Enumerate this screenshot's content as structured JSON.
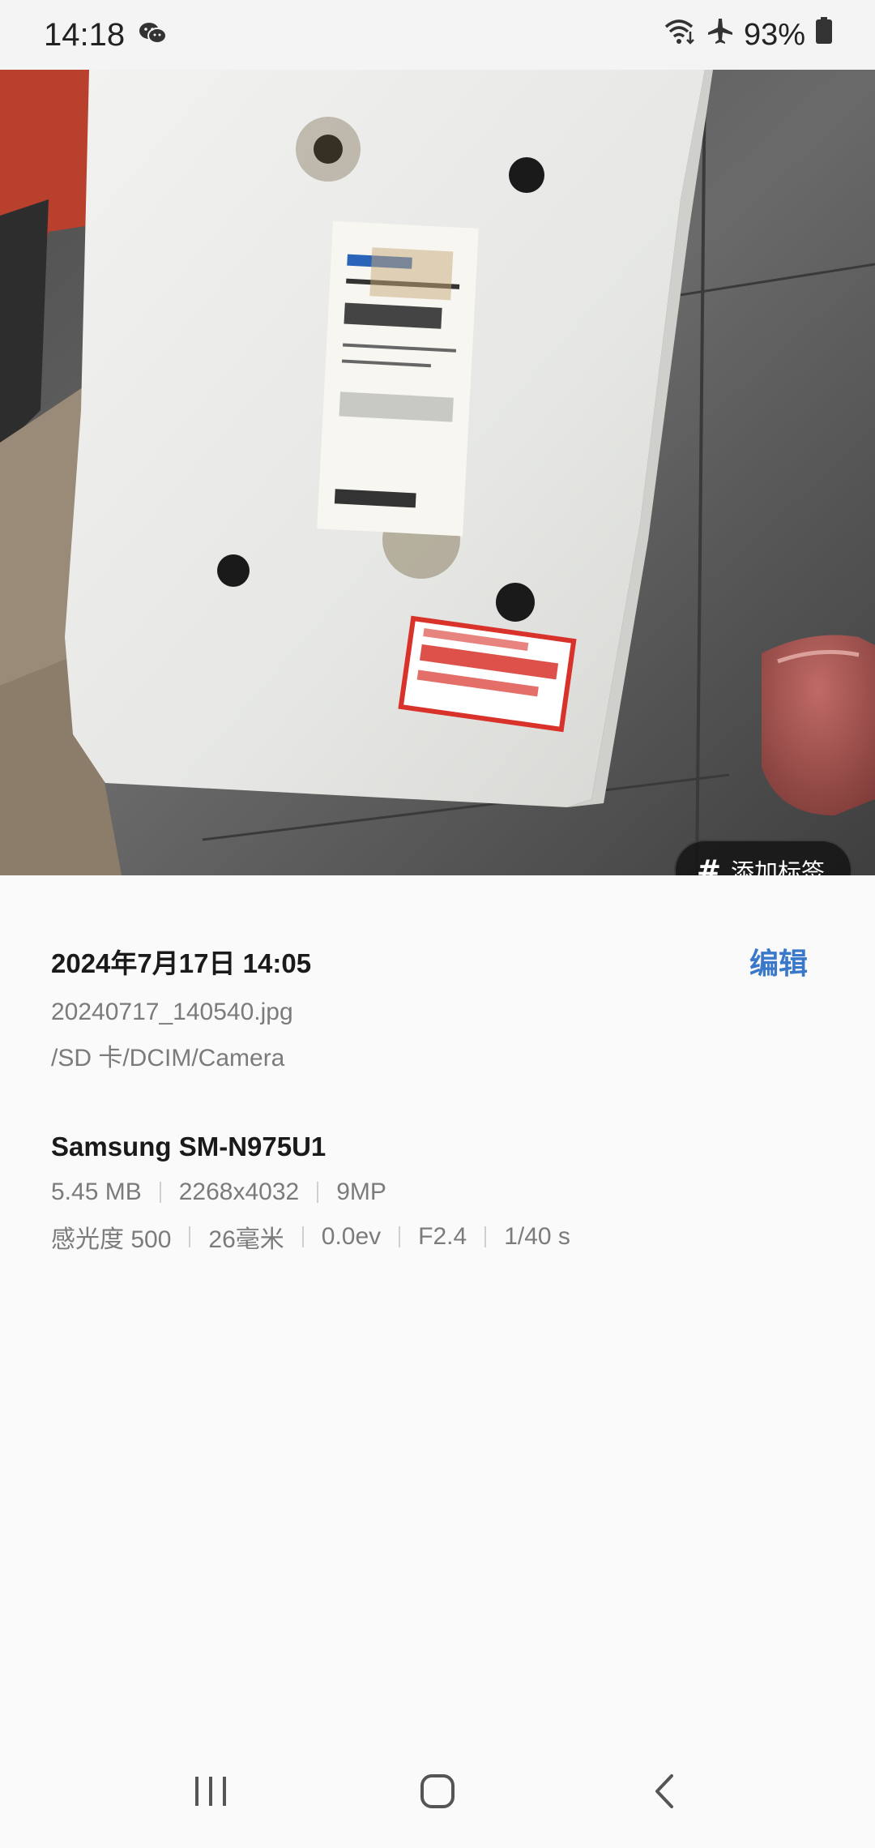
{
  "status_bar": {
    "time": "14:18",
    "battery": "93%",
    "icons": [
      "wechat-icon",
      "wifi-icon",
      "airplane-mode-icon",
      "battery-icon"
    ]
  },
  "photo": {
    "tag_button_label": "添加标签"
  },
  "details": {
    "date": "2024年7月17日 14:05",
    "edit_label": "编辑",
    "filename": "20240717_140540.jpg",
    "path": "/SD 卡/DCIM/Camera",
    "device": "Samsung SM-N975U1",
    "file_size": "5.45 MB",
    "resolution": "2268x4032",
    "megapixels": "9MP",
    "iso": "感光度 500",
    "focal_length": "26毫米",
    "exposure_value": "0.0ev",
    "aperture": "F2.4",
    "shutter_speed": "1/40 s"
  },
  "nav_bar": {
    "buttons": [
      "recent-apps",
      "home",
      "back"
    ]
  },
  "colors": {
    "accent": "#3a78c9",
    "background": "#fafafa",
    "secondary_text": "#7b7b7b"
  }
}
